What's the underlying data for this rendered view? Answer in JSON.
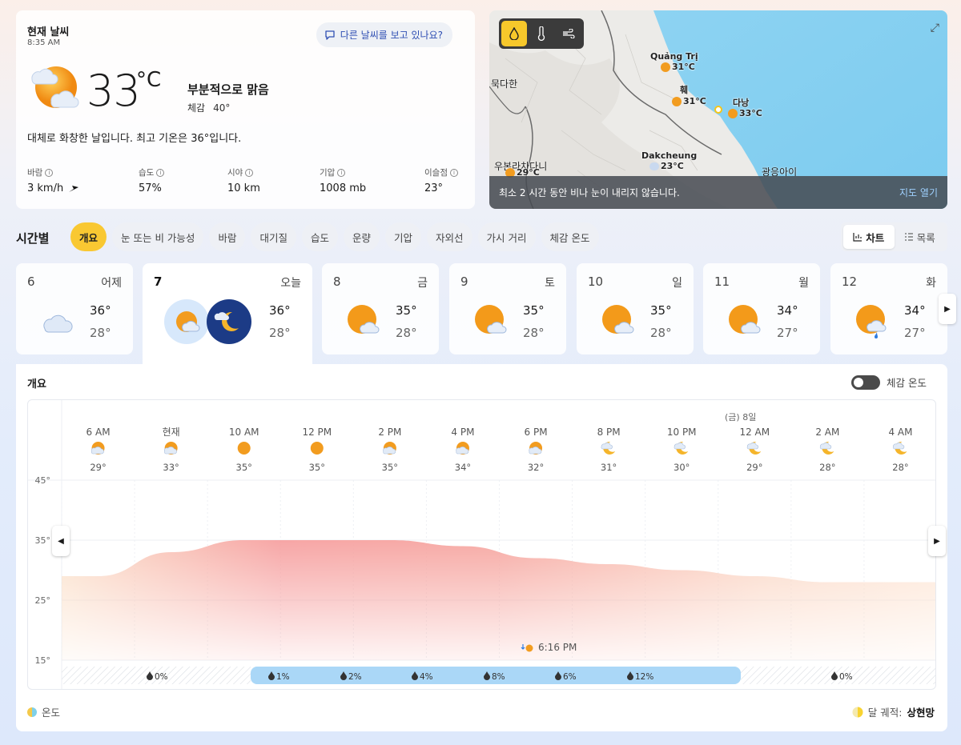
{
  "current": {
    "title": "현재 날씨",
    "time": "8:35 AM",
    "other_weather": "다른 날씨를 보고 있나요?",
    "temp": "33",
    "unit": "°C",
    "condition": "부분적으로 맑음",
    "feels_label": "체감",
    "feels_value": "40°",
    "summary": "대체로 화창한 날입니다. 최고 기온은 36°입니다.",
    "metrics": [
      {
        "label": "바람",
        "value": "3 km/h"
      },
      {
        "label": "습도",
        "value": "57%"
      },
      {
        "label": "시야",
        "value": "10 km"
      },
      {
        "label": "기압",
        "value": "1008 mb"
      },
      {
        "label": "이슬점",
        "value": "23°"
      }
    ]
  },
  "map": {
    "labels": [
      {
        "name": "Quảng Trị",
        "temp": "31°C"
      },
      {
        "name": "훼",
        "temp": "31°C"
      },
      {
        "name": "다낭",
        "temp": "33°C"
      },
      {
        "name": "Dakcheung",
        "temp": "23°C"
      },
      {
        "name": "우본라차다니",
        "temp": "29°C"
      }
    ],
    "cities": [
      "묵다한",
      "광응아이"
    ],
    "footer_text": "최소 2 시간 동안 비나 눈이 내리지 않습니다.",
    "open_map": "지도 열기",
    "layer_icons": [
      "raindrop-icon",
      "thermometer-icon",
      "wind-icon"
    ]
  },
  "hourly": {
    "title": "시간별",
    "tabs": [
      "개요",
      "눈 또는 비 가능성",
      "바람",
      "대기질",
      "습도",
      "운량",
      "기압",
      "자외선",
      "가시 거리",
      "체감 온도"
    ],
    "view_chart": "차트",
    "view_list": "목록"
  },
  "days": [
    {
      "num": "6",
      "name": "어제",
      "hi": "36°",
      "lo": "28°"
    },
    {
      "num": "7",
      "name": "오늘",
      "hi": "36°",
      "lo": "28°"
    },
    {
      "num": "8",
      "name": "금",
      "hi": "35°",
      "lo": "28°"
    },
    {
      "num": "9",
      "name": "토",
      "hi": "35°",
      "lo": "28°"
    },
    {
      "num": "10",
      "name": "일",
      "hi": "35°",
      "lo": "28°"
    },
    {
      "num": "11",
      "name": "월",
      "hi": "34°",
      "lo": "27°"
    },
    {
      "num": "12",
      "name": "화",
      "hi": "34°",
      "lo": "27°"
    }
  ],
  "overview": {
    "title": "개요",
    "feels_toggle": "체감 온도",
    "legend_temp": "온도",
    "moon_label": "달 궤적:",
    "moon_phase": "상현망",
    "sunset": "6:16 PM",
    "next_day_label": "(금) 8일"
  },
  "chart_data": {
    "type": "area",
    "hours": [
      "6 AM",
      "현재",
      "10 AM",
      "12 PM",
      "2 PM",
      "4 PM",
      "6 PM",
      "8 PM",
      "10 PM",
      "12 AM",
      "2 AM",
      "4 AM"
    ],
    "temps": [
      29,
      33,
      35,
      35,
      35,
      34,
      32,
      31,
      30,
      29,
      28,
      28
    ],
    "temp_labels": [
      "29°",
      "33°",
      "35°",
      "35°",
      "35°",
      "34°",
      "32°",
      "31°",
      "30°",
      "29°",
      "28°",
      "28°"
    ],
    "yticks": [
      "45°",
      "35°",
      "25°",
      "15°"
    ],
    "ylim": [
      15,
      45
    ],
    "precip": [
      "0%",
      "1%",
      "2%",
      "4%",
      "8%",
      "6%",
      "12%",
      "0%"
    ],
    "precip_values": [
      0,
      1,
      2,
      4,
      8,
      6,
      12,
      0
    ]
  }
}
